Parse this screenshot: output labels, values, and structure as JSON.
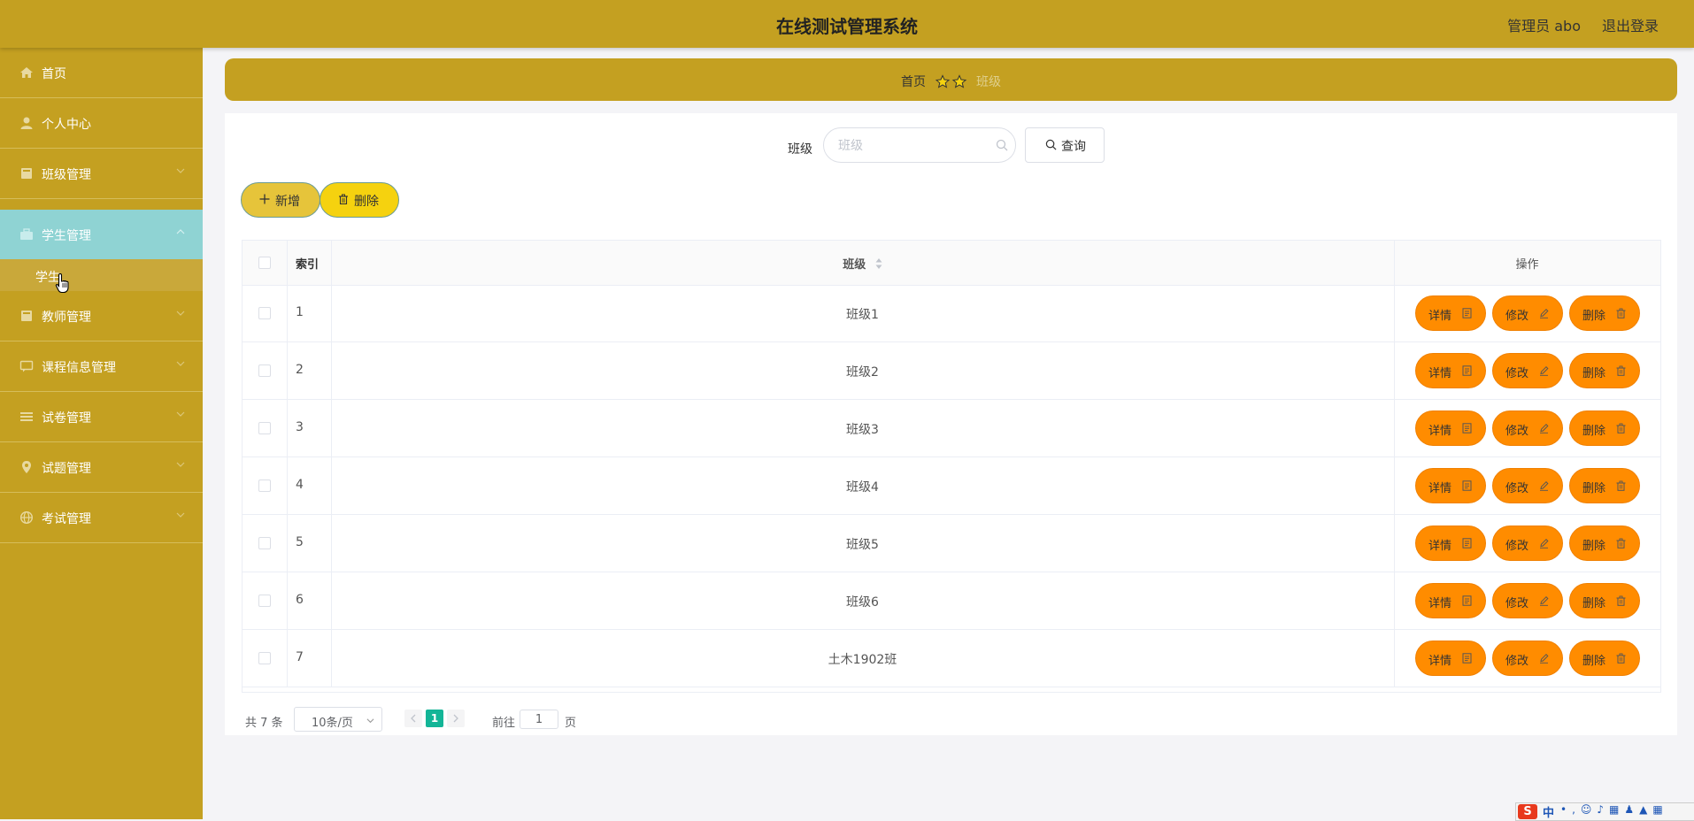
{
  "header": {
    "title": "在线测试管理系统",
    "user": "管理员 abo",
    "logout": "退出登录"
  },
  "sidebar": {
    "items": [
      {
        "label": "首页",
        "icon": "home-icon"
      },
      {
        "label": "个人中心",
        "icon": "user-icon"
      },
      {
        "label": "班级管理",
        "icon": "book-icon"
      },
      {
        "label": "学生管理",
        "icon": "briefcase-icon",
        "active": true
      },
      {
        "label": "教师管理",
        "icon": "book-icon"
      },
      {
        "label": "课程信息管理",
        "icon": "chat-icon"
      },
      {
        "label": "试卷管理",
        "icon": "list-icon"
      },
      {
        "label": "试题管理",
        "icon": "location-icon"
      },
      {
        "label": "考试管理",
        "icon": "globe-icon"
      }
    ],
    "submenu": {
      "label": "学生"
    }
  },
  "breadcrumb": {
    "home": "首页",
    "current": "班级"
  },
  "search": {
    "label": "班级",
    "placeholder": "班级",
    "value": "",
    "query_button": "查询"
  },
  "actions": {
    "add": "新增",
    "delete": "删除"
  },
  "table": {
    "columns": {
      "index": "索引",
      "class": "班级",
      "ops": "操作"
    },
    "rows": [
      {
        "index": "1",
        "class": "班级1"
      },
      {
        "index": "2",
        "class": "班级2"
      },
      {
        "index": "3",
        "class": "班级3"
      },
      {
        "index": "4",
        "class": "班级4"
      },
      {
        "index": "5",
        "class": "班级5"
      },
      {
        "index": "6",
        "class": "班级6"
      },
      {
        "index": "7",
        "class": "土木1902班"
      }
    ],
    "row_buttons": {
      "detail": "详情",
      "edit": "修改",
      "delete": "删除"
    }
  },
  "pagination": {
    "total": "共 7 条",
    "page_size": "10条/页",
    "current_page": "1",
    "goto_label": "前往",
    "goto_value": "1",
    "goto_suffix": "页"
  },
  "ime": {
    "logo": "S",
    "mode": "中"
  },
  "colors": {
    "header": "#c4a021",
    "sidebar": "#c4a021",
    "active_menu": "#8fd3d3",
    "op_button": "#ff8c00",
    "add_button": "#e6c43a",
    "delete_button": "#f5d20f",
    "page_active": "#13b597"
  }
}
